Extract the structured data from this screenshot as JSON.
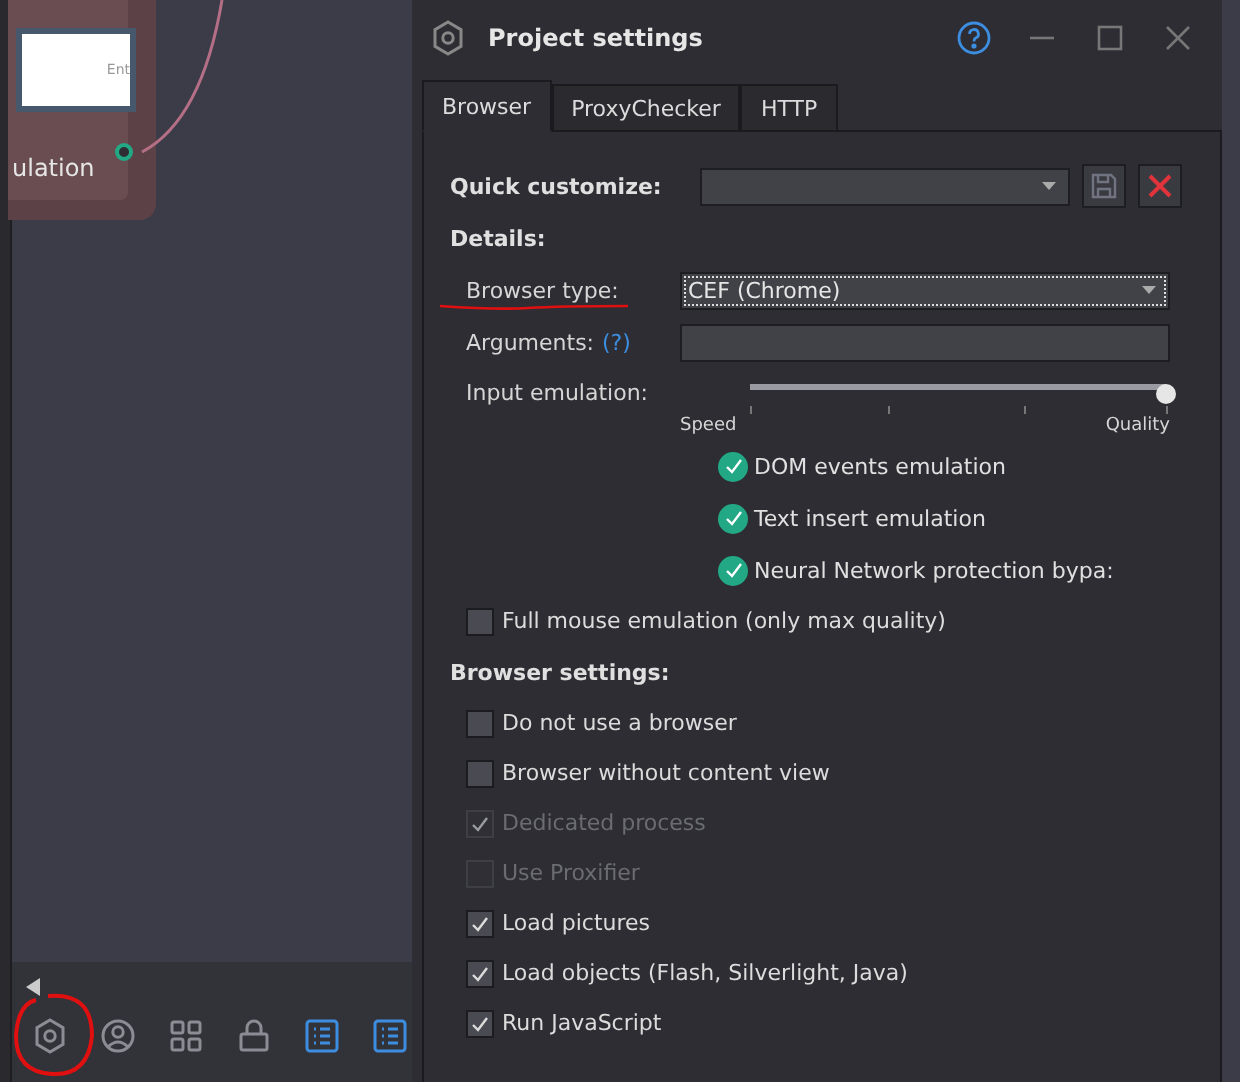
{
  "canvas": {
    "node": {
      "label": "ulation",
      "thumbnail_text": "Ent"
    },
    "toolbar": [
      {
        "kind": "gear",
        "selected": false
      },
      {
        "kind": "user",
        "selected": false
      },
      {
        "kind": "grid",
        "selected": false
      },
      {
        "kind": "lock",
        "selected": false
      },
      {
        "kind": "list",
        "selected": true
      },
      {
        "kind": "list",
        "selected": true
      }
    ]
  },
  "dialog": {
    "title": "Project settings",
    "tabs": [
      {
        "label": "Browser",
        "selected": true
      },
      {
        "label": "ProxyChecker",
        "selected": false
      },
      {
        "label": "HTTP",
        "selected": false
      }
    ],
    "quick_customize": {
      "label": "Quick customize:"
    },
    "details_heading": "Details:",
    "browser_type": {
      "label": "Browser type:",
      "value": "CEF (Chrome)"
    },
    "arguments": {
      "label": "Arguments:",
      "help": "(?)"
    },
    "input_emulation": {
      "label": "Input emulation:",
      "level": 1,
      "min_label": "Speed",
      "max_label": "Quality"
    },
    "emulation_features": [
      {
        "label": "DOM events emulation",
        "checked": true
      },
      {
        "label": "Text insert emulation",
        "checked": true
      },
      {
        "label": "Neural Network protection bypa:",
        "checked": true
      }
    ],
    "full_mouse": {
      "label": "Full mouse emulation (only max quality)",
      "checked": false
    },
    "browser_settings_heading": "Browser settings:",
    "browser_settings": [
      {
        "label": "Do not use a browser",
        "checked": false,
        "disabled": false
      },
      {
        "label": "Browser without content view",
        "checked": false,
        "disabled": false
      },
      {
        "label": "Dedicated process",
        "checked": true,
        "disabled": true
      },
      {
        "label": "Use Proxifier",
        "checked": false,
        "disabled": true
      },
      {
        "label": "Load pictures",
        "checked": true,
        "disabled": false
      },
      {
        "label": "Load objects (Flash, Silverlight, Java)",
        "checked": true,
        "disabled": false
      },
      {
        "label": "Run JavaScript",
        "checked": true,
        "disabled": false
      }
    ]
  }
}
